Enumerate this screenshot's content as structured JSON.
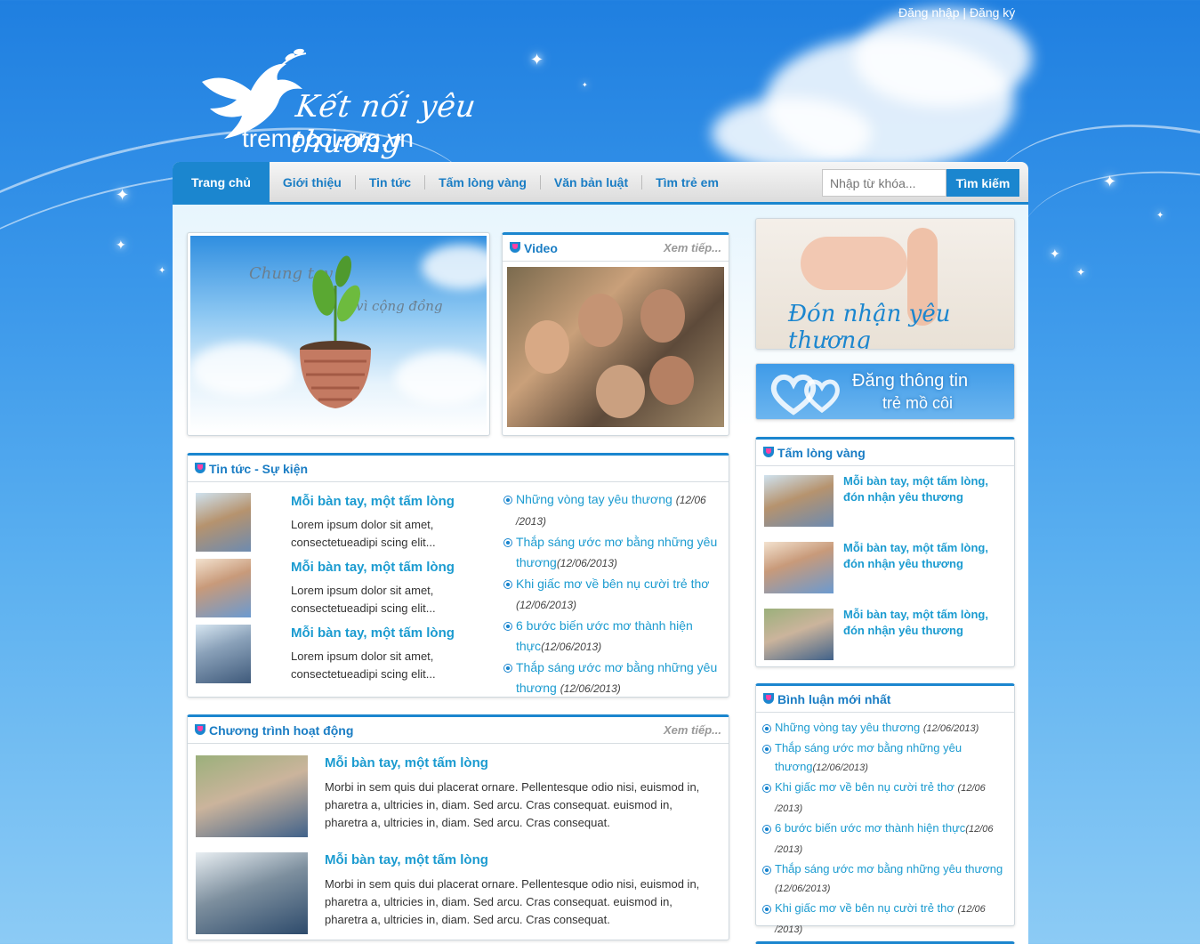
{
  "top_links": {
    "login": "Đăng nhập",
    "separator": "|",
    "register": "Đăng ký"
  },
  "logo": {
    "tagline": "Kết nối yêu thương",
    "domain": "tremocoi.org.vn"
  },
  "nav": {
    "items": [
      "Trang chủ",
      "Giới thiệu",
      "Tin tức",
      "Tấm lòng vàng",
      "Văn bản luật",
      "Tìm trẻ em"
    ],
    "active_index": 0
  },
  "search": {
    "placeholder": "Nhập từ khóa...",
    "button": "Tìm kiếm"
  },
  "banner": {
    "line1": "Chung tay",
    "line2": "vì cộng đồng"
  },
  "video": {
    "title": "Video",
    "more": "Xem tiếp..."
  },
  "news": {
    "title": "Tin tức - Sự kiện",
    "items": [
      {
        "title": "Mỗi bàn tay, một tấm lòng",
        "desc": "Lorem ipsum dolor sit amet, consectetueadipi scing elit..."
      },
      {
        "title": "Mỗi bàn tay, một tấm lòng",
        "desc": "Lorem ipsum dolor sit amet, consectetueadipi scing elit..."
      },
      {
        "title": "Mỗi bàn tay, một tấm lòng",
        "desc": "Lorem ipsum dolor sit amet, consectetueadipi scing elit..."
      }
    ],
    "links": [
      {
        "text": "Những vòng tay yêu thương",
        "date": "(12/06 /2013)"
      },
      {
        "text": "Thắp sáng ước mơ bằng những yêu thương",
        "date": "(12/06/2013)"
      },
      {
        "text": "Khi giấc mơ về bên nụ cười trẻ thơ",
        "date": "(12/06/2013)"
      },
      {
        "text": "6 bước biến ước mơ thành hiện thực",
        "date": "(12/06/2013)"
      },
      {
        "text": "Thắp sáng ước mơ bằng những yêu thương",
        "date": "(12/06/2013)"
      }
    ]
  },
  "programs": {
    "title": "Chương trình hoạt động",
    "more": "Xem tiếp...",
    "items": [
      {
        "title": "Mỗi bàn tay, một tấm lòng",
        "desc": "Morbi in sem quis dui placerat ornare. Pellentesque odio nisi, euismod in, pharetra a, ultricies in, diam. Sed arcu. Cras consequat. euismod in, pharetra a, ultricies in, diam. Sed arcu. Cras consequat."
      },
      {
        "title": "Mỗi bàn tay, một tấm lòng",
        "desc": "Morbi in sem quis dui placerat ornare. Pellentesque odio nisi, euismod in, pharetra a, ultricies in, diam. Sed arcu. Cras consequat. euismod in, pharetra a, ultricies in, diam. Sed arcu. Cras consequat."
      }
    ]
  },
  "side_banner1": {
    "text": "Đón nhận yêu thương"
  },
  "side_banner2": {
    "line1": "Đăng thông tin",
    "line2": "trẻ mồ côi"
  },
  "golden": {
    "title": "Tấm lòng vàng",
    "items": [
      "Mỗi bàn tay, một tấm lòng, đón nhận yêu thương",
      "Mỗi bàn tay, một tấm lòng, đón nhận yêu thương",
      "Mỗi bàn tay, một tấm lòng, đón nhận yêu thương"
    ]
  },
  "comments": {
    "title": "Bình luận mới nhất",
    "items": [
      {
        "text": "Những vòng tay yêu thương",
        "date": "(12/06/2013)"
      },
      {
        "text": "Thắp sáng ước mơ bằng những yêu thương",
        "date": "(12/06/2013)"
      },
      {
        "text": "Khi giấc mơ về bên nụ cười trẻ thơ",
        "date": "(12/06 /2013)"
      },
      {
        "text": "6 bước biến ước mơ thành hiện thực",
        "date": "(12/06 /2013)"
      },
      {
        "text": "Thắp sáng ước mơ bằng những yêu thương",
        "date": "(12/06/2013)"
      },
      {
        "text": "Khi giấc mơ về bên nụ cười trẻ thơ",
        "date": "(12/06 /2013)"
      }
    ]
  },
  "colors": {
    "accent": "#1b86cf",
    "link": "#1b9bd0",
    "sky": "#1f7fe0"
  }
}
